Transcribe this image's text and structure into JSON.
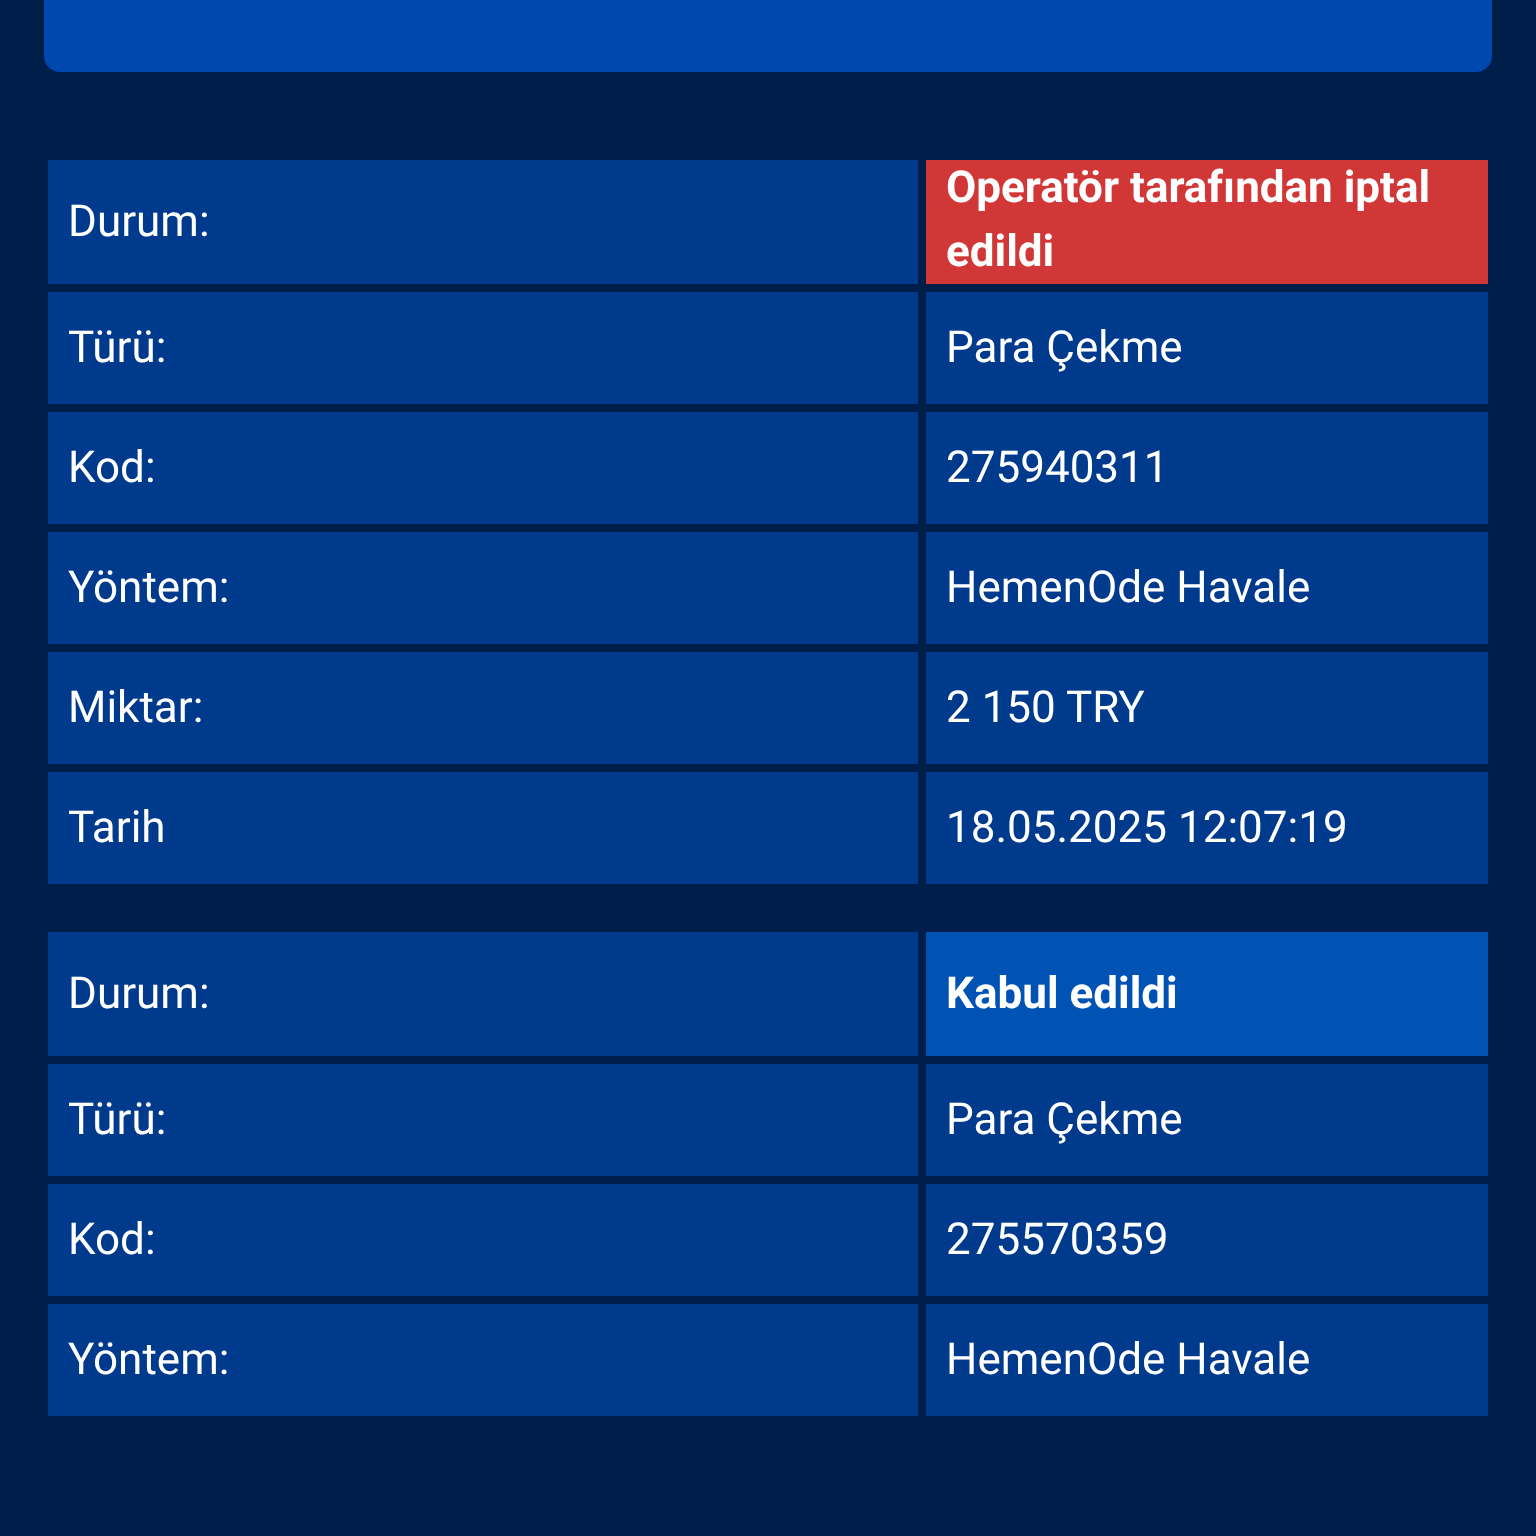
{
  "transactions": [
    {
      "status": {
        "label": "Durum:",
        "value": "Operatör tarafından iptal edildi",
        "kind": "cancelled"
      },
      "fields": [
        {
          "label": "Türü:",
          "value": "Para Çekme"
        },
        {
          "label": "Kod:",
          "value": "275940311"
        },
        {
          "label": "Yöntem:",
          "value": "HemenOde Havale"
        },
        {
          "label": "Miktar:",
          "value": "2 150 TRY"
        },
        {
          "label": "Tarih",
          "value": "18.05.2025 12:07:19"
        }
      ]
    },
    {
      "status": {
        "label": "Durum:",
        "value": "Kabul edildi",
        "kind": "accepted"
      },
      "fields": [
        {
          "label": "Türü:",
          "value": "Para Çekme"
        },
        {
          "label": "Kod:",
          "value": "275570359"
        },
        {
          "label": "Yöntem:",
          "value": "HemenOde Havale"
        }
      ]
    }
  ]
}
